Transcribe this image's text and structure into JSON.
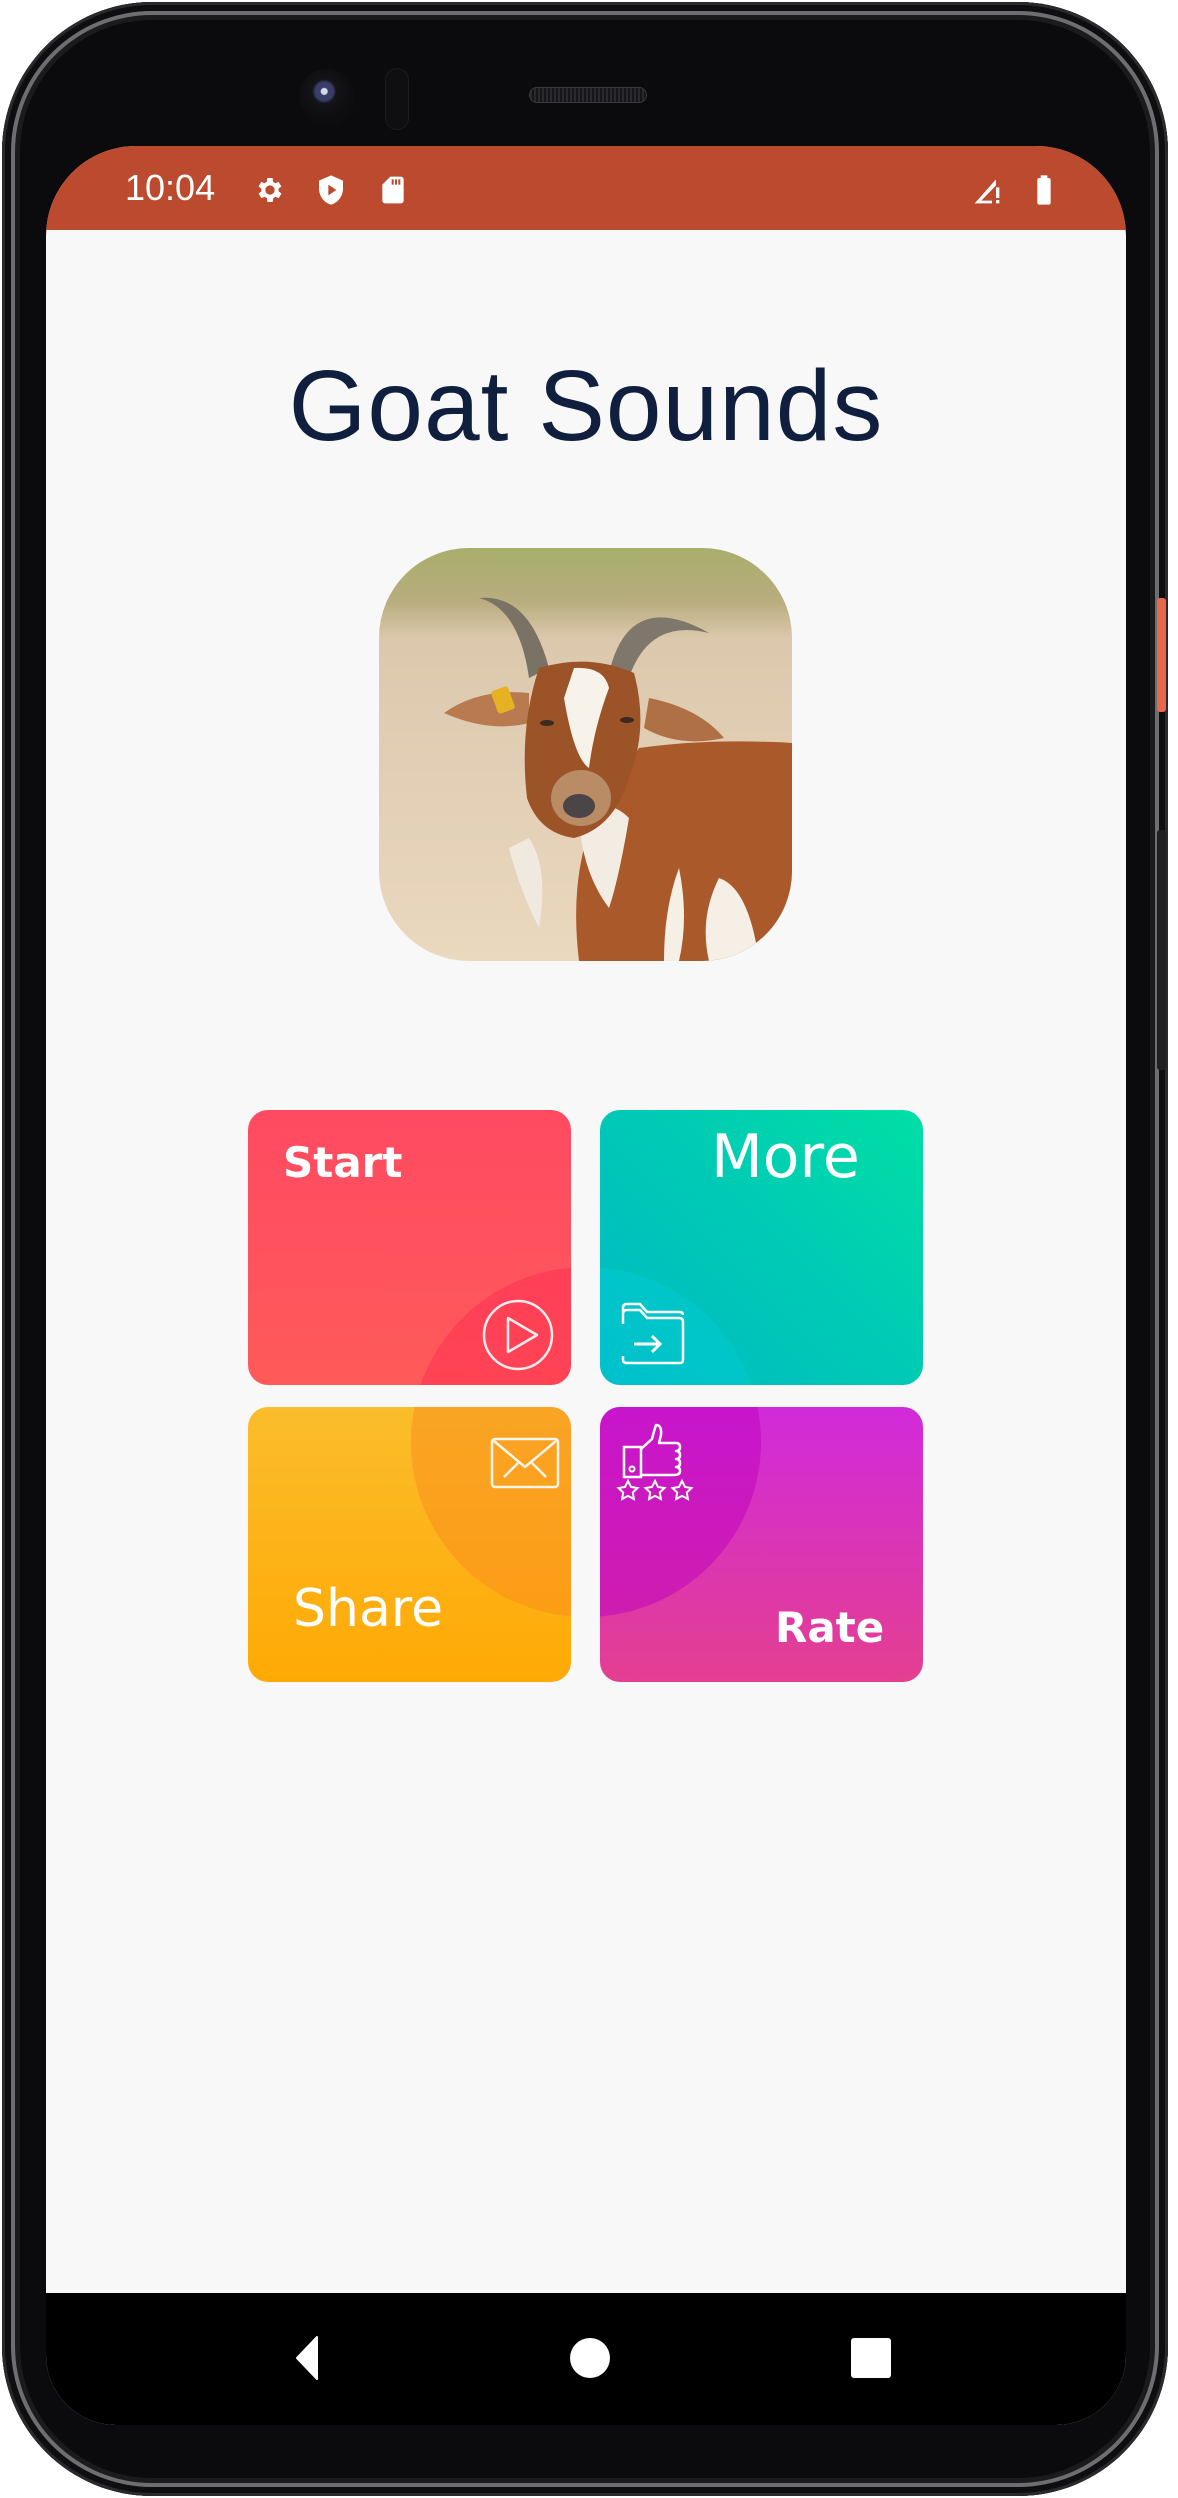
{
  "status_bar": {
    "time": "10:04",
    "icons": [
      "gear-icon",
      "shield-play-icon",
      "sd-card-icon",
      "signal-alert-icon",
      "battery-icon"
    ],
    "color": "#bb4a2e"
  },
  "app": {
    "title": "Goat Sounds",
    "hero_image": "goat-photo"
  },
  "tiles": [
    {
      "id": "start",
      "label": "Start",
      "icon": "play-circle-icon",
      "colors": [
        "#ff4a61",
        "#ff5a5a"
      ]
    },
    {
      "id": "more",
      "label": "More",
      "icon": "folder-arrow-icon",
      "colors": [
        "#00b8c4",
        "#00dfa5"
      ]
    },
    {
      "id": "share",
      "label": "Share",
      "icon": "envelope-icon",
      "colors": [
        "#fbbd2c",
        "#ffa904"
      ]
    },
    {
      "id": "rate",
      "label": "Rate",
      "icon": "thumbs-up-stars-icon",
      "colors": [
        "#d12adb",
        "#e43f90"
      ]
    }
  ],
  "nav_bar": {
    "buttons": [
      "back",
      "home",
      "recents"
    ]
  }
}
